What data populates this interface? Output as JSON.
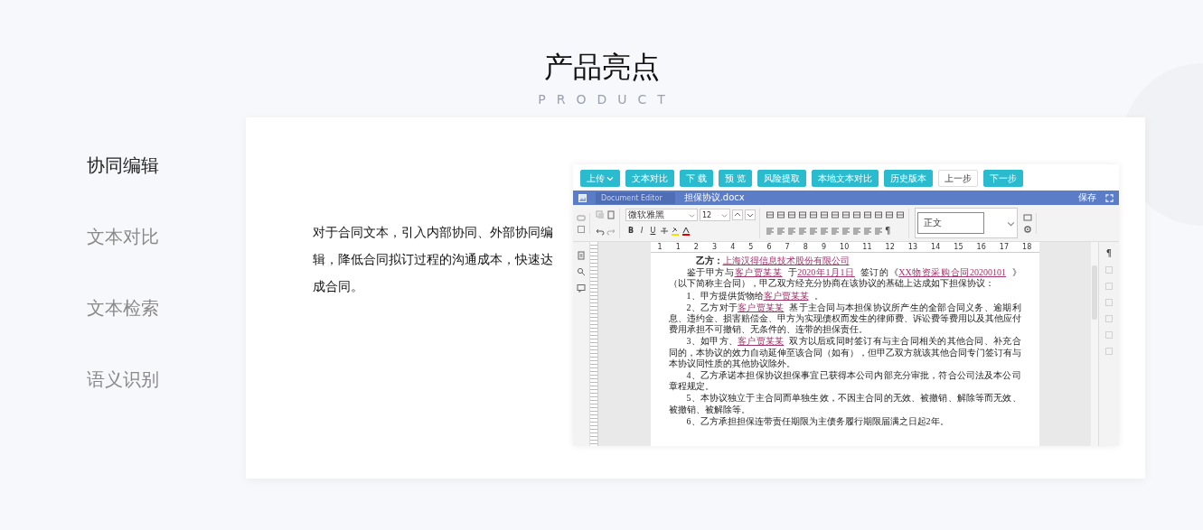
{
  "header": {
    "title": "产品亮点",
    "subtitle": "PRODUCT"
  },
  "features": [
    {
      "label": "协同编辑",
      "selected": true
    },
    {
      "label": "文本对比",
      "selected": false
    },
    {
      "label": "文本检索",
      "selected": false
    },
    {
      "label": "语义识别",
      "selected": false
    }
  ],
  "description": "对于合同文本，引入内部协同、外部协同编辑，降低合同拟订过程的沟通成本，快速达成合同。",
  "editor": {
    "action_buttons": [
      {
        "label": "上传",
        "kind": "dropdown"
      },
      {
        "label": "文本对比",
        "kind": "primary"
      },
      {
        "label": "下 载",
        "kind": "primary"
      },
      {
        "label": "预 览",
        "kind": "primary"
      },
      {
        "label": "风险提取",
        "kind": "primary"
      },
      {
        "label": "本地文本对比",
        "kind": "primary"
      },
      {
        "label": "历史版本",
        "kind": "primary"
      },
      {
        "label": "上一步",
        "kind": "outline"
      },
      {
        "label": "下一步",
        "kind": "primary"
      }
    ],
    "breadcrumb": [
      "Document Editor",
      "担保协议.docx"
    ],
    "save_label": "保存",
    "font_name": "微软雅黑",
    "font_size": "12",
    "style_name": "正文",
    "format_letters": [
      "B",
      "I",
      "U"
    ],
    "pilcrow": "¶",
    "ruler_labels": [
      "1",
      "1",
      "2",
      "3",
      "4",
      "5",
      "6",
      "7",
      "8",
      "9",
      "10",
      "11",
      "12",
      "13",
      "14",
      "15",
      "16",
      "17",
      "18"
    ],
    "paragraphs": [
      {
        "kind": "party",
        "segments": [
          {
            "kind": "bold",
            "text": "乙方："
          },
          {
            "kind": "field",
            "text": "上海汉得信息技术股份有限公司"
          }
        ]
      },
      {
        "kind": "body",
        "segments": [
          {
            "kind": "plain",
            "text": "鉴于甲方与"
          },
          {
            "kind": "field",
            "text": "客户贾某某"
          },
          {
            "kind": "plain",
            "text": "于"
          },
          {
            "kind": "field",
            "text": "2020年1月1日"
          },
          {
            "kind": "plain",
            "text": "签订的《"
          },
          {
            "kind": "field",
            "text": "XX物资采购合同20200101"
          },
          {
            "kind": "plain",
            "text": "》（以下简称主合同），甲乙双方经充分协商在该协议的基础上达成如下担保协议："
          }
        ]
      },
      {
        "kind": "body",
        "segments": [
          {
            "kind": "plain",
            "text": "1、甲方提供货物给"
          },
          {
            "kind": "field",
            "text": "客户贾某某"
          },
          {
            "kind": "plain",
            "text": "。"
          }
        ]
      },
      {
        "kind": "body",
        "segments": [
          {
            "kind": "plain",
            "text": "2、乙方对于"
          },
          {
            "kind": "field",
            "text": "客户贾某某"
          },
          {
            "kind": "plain",
            "text": "基于主合同与本担保协议所产生的全部合同义务、逾期利息、违约金、损害赔偿金、甲方为实现债权而发生的律师费、诉讼费等费用以及其他应付费用承担不可撤销、无条件的、连带的担保责任。"
          }
        ]
      },
      {
        "kind": "body",
        "segments": [
          {
            "kind": "plain",
            "text": "3、如甲方、"
          },
          {
            "kind": "field",
            "text": "客户贾某某"
          },
          {
            "kind": "plain",
            "text": "双方以后或同时签订有与主合同相关的其他合同、补充合同的，本协议的效力自动延伸至该合同（如有），但甲乙双方就该其他合同专门签订有与本协议同性质的其他协议除外。"
          }
        ]
      },
      {
        "kind": "body",
        "segments": [
          {
            "kind": "plain",
            "text": "4、乙方承诺本担保协议担保事宜已获得本公司内部充分审批，符合公司法及本公司章程规定。"
          }
        ]
      },
      {
        "kind": "body",
        "segments": [
          {
            "kind": "plain",
            "text": "5、本协议独立于主合同而单独生效，不因主合同的无效、被撤销、解除等而无效、被撤销、被解除等。"
          }
        ]
      },
      {
        "kind": "body",
        "segments": [
          {
            "kind": "plain",
            "text": "6、乙方承担担保连带责任期限为主债务履行期限届满之日起2年。"
          }
        ]
      }
    ]
  }
}
